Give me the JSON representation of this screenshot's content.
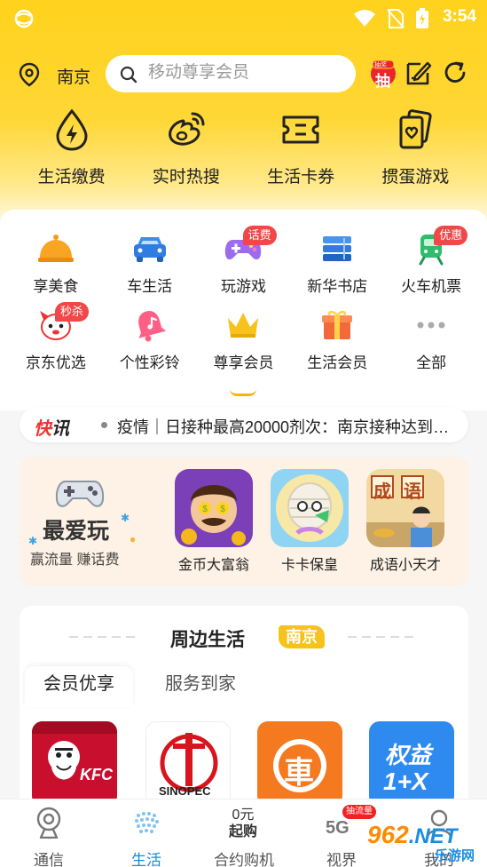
{
  "status_bar": {
    "time": "3:54"
  },
  "header": {
    "city": "南京",
    "search": {
      "placeholder": "移动尊享会员"
    },
    "lottery_badge_top": "抽奖",
    "lottery_badge_main": "抽"
  },
  "quick_services": [
    {
      "label": "生活缴费",
      "icon": "water-drop-bolt-icon"
    },
    {
      "label": "实时热搜",
      "icon": "weibo-icon"
    },
    {
      "label": "生活卡券",
      "icon": "ticket-icon"
    },
    {
      "label": "掼蛋游戏",
      "icon": "playing-cards-icon"
    }
  ],
  "grid_row1": [
    {
      "label": "享美食",
      "icon": "food-cloche-icon"
    },
    {
      "label": "车生活",
      "icon": "car-icon"
    },
    {
      "label": "玩游戏",
      "icon": "gamepad-icon",
      "tag": "话费"
    },
    {
      "label": "新华书店",
      "icon": "books-icon"
    },
    {
      "label": "火车机票",
      "icon": "train-icon",
      "tag": "优惠"
    }
  ],
  "grid_row2": [
    {
      "label": "京东优选",
      "icon": "jd-dog-icon",
      "tag": "秒杀"
    },
    {
      "label": "个性彩铃",
      "icon": "bell-icon"
    },
    {
      "label": "尊享会员",
      "icon": "crown-icon"
    },
    {
      "label": "生活会员",
      "icon": "gift-box-icon"
    },
    {
      "label": "全部",
      "icon": "more-dots-icon"
    }
  ],
  "news": {
    "logo_prefix": "快",
    "logo_suffix": "讯",
    "text": "疫情｜日接种最高20000剂次：南京接种达到南..."
  },
  "games": {
    "title": "最爱玩",
    "subtitle": "赢流量 赚话费",
    "items": [
      {
        "label": "金币大富翁"
      },
      {
        "label": "卡卡保皇"
      },
      {
        "label": "成语小天才",
        "thumb_text": "成语"
      }
    ]
  },
  "nearby": {
    "title": "周边生活",
    "city": "南京",
    "tabs": [
      "会员优享",
      "服务到家"
    ],
    "brands": [
      {
        "name": "KFC",
        "logo_text": "KFC"
      },
      {
        "name": "中国石化 SINOPEC",
        "logo_text": "SINOPEC"
      },
      {
        "name": "车",
        "logo_text": "車"
      },
      {
        "name": "权益1+X",
        "logo_line1": "权益",
        "logo_line2": "1+X"
      }
    ]
  },
  "bottom_nav": [
    {
      "label": "通信",
      "icon": "signal-tower-icon"
    },
    {
      "label": "生活",
      "icon": "life-dots-icon",
      "active": true
    },
    {
      "label": "合约购机",
      "promo_line1": "0元",
      "promo_line2": "起购"
    },
    {
      "label": "视界",
      "icon": "5g-icon",
      "badge": "抽流量"
    },
    {
      "label": "我的",
      "icon": "profile-icon"
    }
  ],
  "watermark": {
    "number": "962",
    "domain": ".NET",
    "text": "乐游网"
  },
  "colors": {
    "accent_yellow": "#ffd21c",
    "tag_red": "#f04848",
    "active_blue": "#1a8bd8"
  }
}
